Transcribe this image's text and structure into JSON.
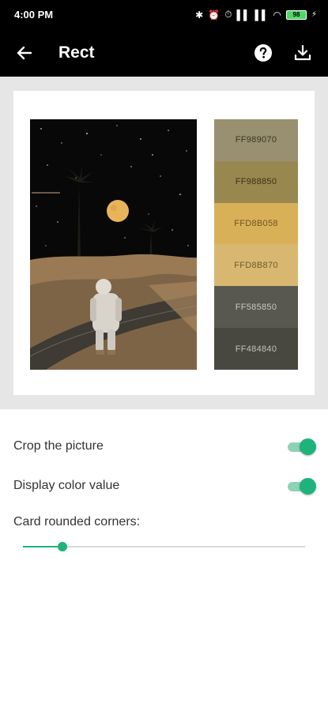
{
  "status_bar": {
    "time": "4:00 PM",
    "battery": "98"
  },
  "app_bar": {
    "title": "Rect",
    "icons": [
      "arrow-left-icon",
      "help-icon",
      "download-icon"
    ]
  },
  "palette": [
    {
      "label": "FF989070",
      "color": "#989070",
      "text_color": "#3a3626"
    },
    {
      "label": "FF988850",
      "color": "#988850",
      "text_color": "#3a3214"
    },
    {
      "label": "FFD8B058",
      "color": "#d8b058",
      "text_color": "#6e5520"
    },
    {
      "label": "FFD8B870",
      "color": "#d8b870",
      "text_color": "#6e5a2c"
    },
    {
      "label": "FF585850",
      "color": "#585850",
      "text_color": "#c8c8c0"
    },
    {
      "label": "FF484840",
      "color": "#484840",
      "text_color": "#c0c0b8"
    }
  ],
  "settings": {
    "crop_label": "Crop the picture",
    "crop_on": true,
    "color_value_label": "Display color value",
    "color_value_on": true,
    "corners_label": "Card rounded corners:",
    "corners_value": 0.14
  },
  "colors": {
    "accent": "#1db37a",
    "accent_light": "#8fd1b4",
    "preview_bg": "#e6e6e6",
    "header_bg": "#000000"
  }
}
